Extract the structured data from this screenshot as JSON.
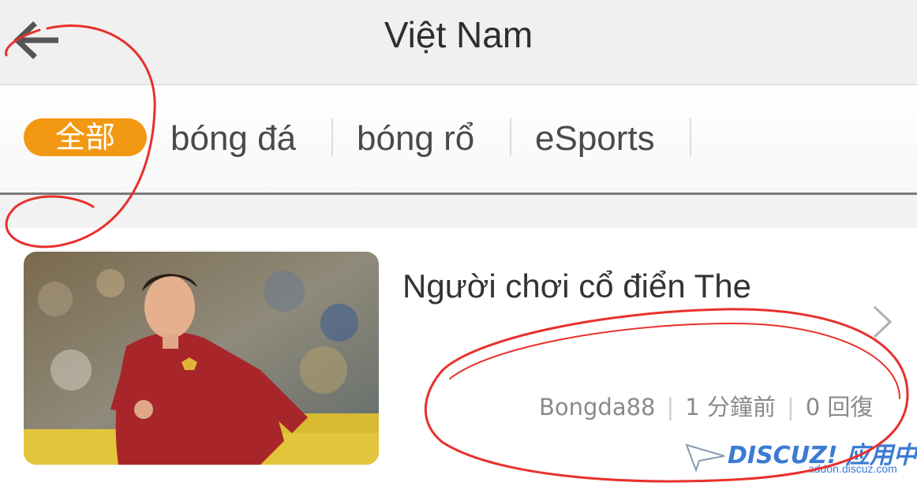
{
  "header": {
    "title": "Việt Nam",
    "back_icon": "back-arrow-icon"
  },
  "tabs": [
    {
      "label": "全部",
      "active": true
    },
    {
      "label": "bóng đá",
      "active": false
    },
    {
      "label": "bóng rổ",
      "active": false
    },
    {
      "label": "eSports",
      "active": false
    }
  ],
  "article": {
    "title": "Người chơi cổ điển The",
    "author": "Bongda88",
    "time": "1 分鐘前",
    "replies": "0 回復",
    "chevron_icon": "chevron-right-icon"
  },
  "watermark": {
    "logo": "DISCUZ! 应用中心",
    "url": "addon.discuz.com"
  },
  "colors": {
    "accent": "#f39812",
    "annotation": "#e8302c",
    "watermark": "#3b7bd4"
  }
}
